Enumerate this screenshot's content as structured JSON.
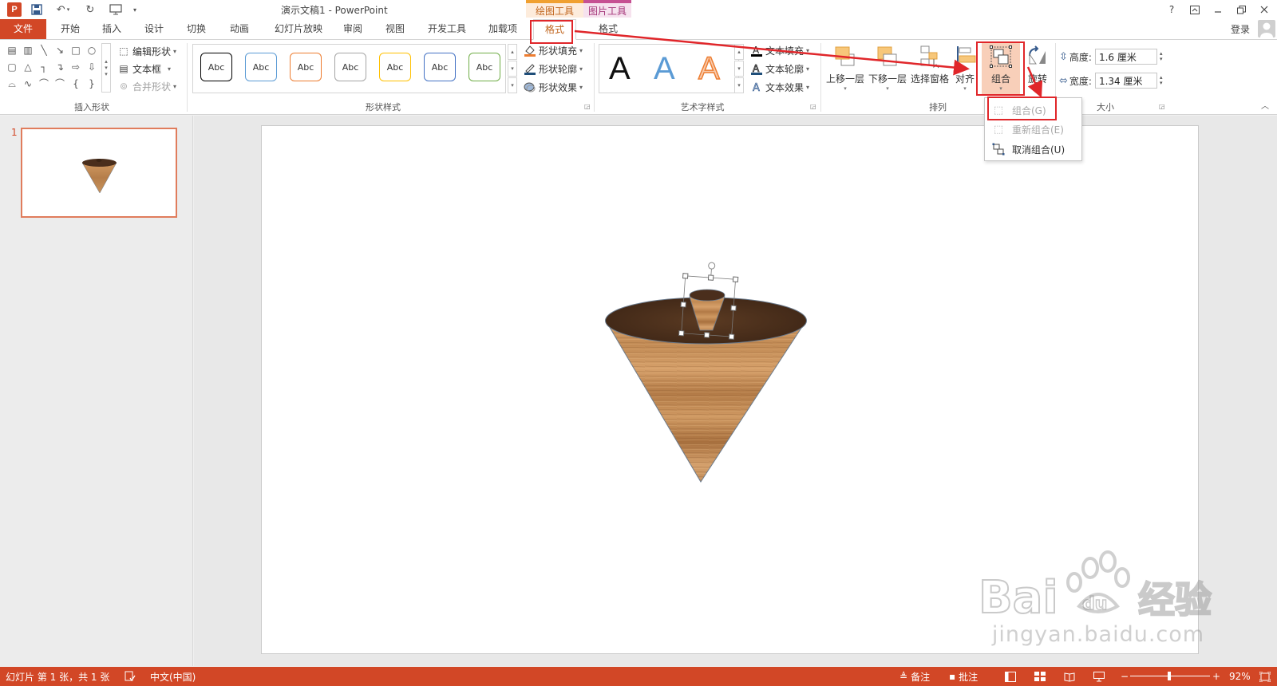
{
  "window": {
    "title": "演示文稿1 - PowerPoint",
    "app_logo_letter": "P",
    "help": "?",
    "login": "登录"
  },
  "context_tabs": {
    "drawing_tools": "绘图工具",
    "picture_tools": "图片工具"
  },
  "tabs": [
    {
      "label": "文件"
    },
    {
      "label": "开始"
    },
    {
      "label": "插入"
    },
    {
      "label": "设计"
    },
    {
      "label": "切换"
    },
    {
      "label": "动画"
    },
    {
      "label": "幻灯片放映"
    },
    {
      "label": "审阅"
    },
    {
      "label": "视图"
    },
    {
      "label": "开发工具"
    },
    {
      "label": "加载项"
    },
    {
      "label": "格式",
      "active": true
    },
    {
      "label": "格式"
    }
  ],
  "ribbon": {
    "insert_shapes": {
      "label": "插入形状",
      "edit_shape": "编辑形状",
      "text_box": "文本框",
      "merge_shapes": "合并形状"
    },
    "shape_styles": {
      "label": "形状样式",
      "style_sample": "Abc",
      "style_colors": [
        "#000000",
        "#5b9bd5",
        "#ed7d31",
        "#a5a5a5",
        "#ffc000",
        "#4472c4",
        "#70ad47"
      ],
      "shape_fill": "形状填充",
      "shape_outline": "形状轮廓",
      "shape_effects": "形状效果"
    },
    "wordart_styles": {
      "label": "艺术字样式",
      "sample": "A",
      "text_fill": "文本填充",
      "text_outline": "文本轮廓",
      "text_effects": "文本效果"
    },
    "arrange": {
      "label": "排列",
      "bring_forward": "上移一层",
      "send_backward": "下移一层",
      "selection_pane": "选择窗格",
      "align": "对齐",
      "group": "组合",
      "rotate": "旋转"
    },
    "size": {
      "label": "大小",
      "height_label": "高度:",
      "height_value": "1.6 厘米",
      "width_label": "宽度:",
      "width_value": "1.34 厘米"
    }
  },
  "group_menu": {
    "items": [
      {
        "label": "组合(G)",
        "disabled": true
      },
      {
        "label": "重新组合(E)",
        "disabled": true
      },
      {
        "label": "取消组合(U)",
        "disabled": false
      }
    ]
  },
  "thumbnails": [
    {
      "number": "1"
    }
  ],
  "statusbar": {
    "slide_info": "幻灯片 第 1 张，共 1 张",
    "language": "中文(中国)",
    "notes": "备注",
    "comments": "批注",
    "zoom": "92%"
  },
  "watermark": {
    "site": "jingyan.baidu.com"
  },
  "colors": {
    "accent": "#d24726",
    "highlight": "#e0262a",
    "wood_light": "#c8925a",
    "wood_dark": "#4a2e1c"
  }
}
